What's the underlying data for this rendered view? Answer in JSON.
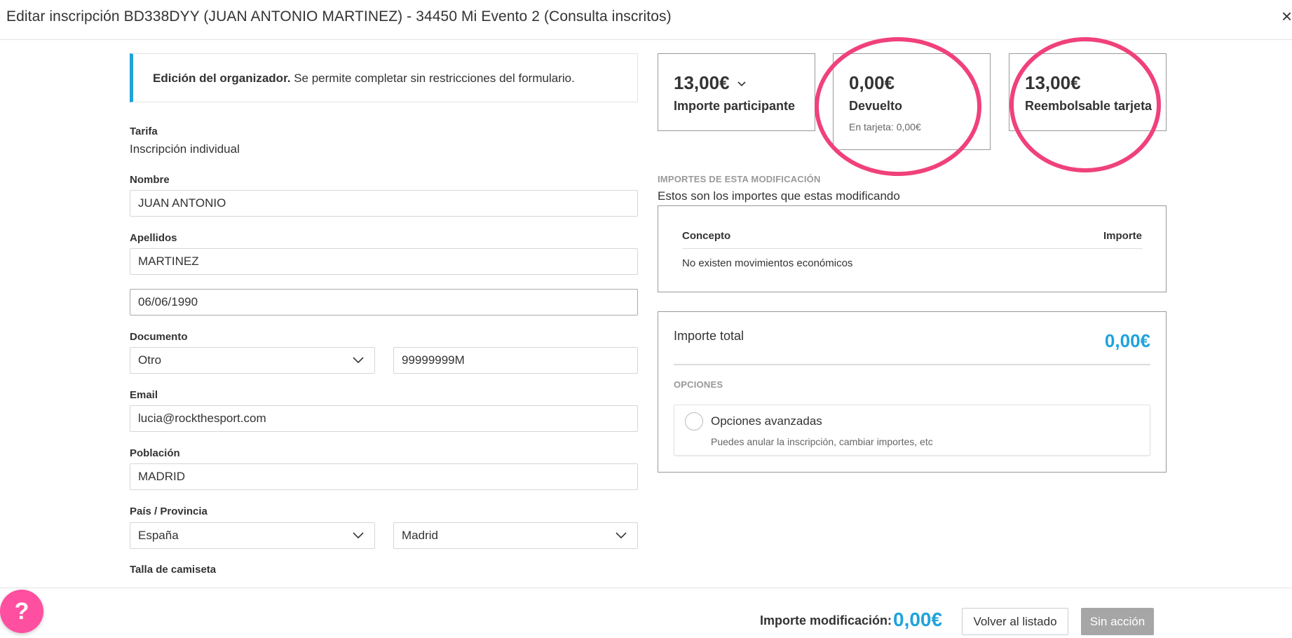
{
  "header": {
    "title": "Editar inscripción BD338DYY (JUAN ANTONIO MARTINEZ) - 34450 Mi Evento 2 (Consulta inscritos)",
    "close_glyph": "×"
  },
  "notice": {
    "bold": "Edición del organizador.",
    "text": " Se permite completar sin restricciones del formulario."
  },
  "form": {
    "tarifa_label": "Tarifa",
    "tarifa_value": "Inscripción individual",
    "nombre_label": "Nombre",
    "nombre_value": "JUAN ANTONIO",
    "apellidos_label": "Apellidos",
    "apellidos_value": "MARTINEZ",
    "fecha_value": "06/06/1990",
    "documento_label": "Documento",
    "documento_tipo": "Otro",
    "documento_numero": "99999999M",
    "email_label": "Email",
    "email_value": "lucia@rockthesport.com",
    "poblacion_label": "Población",
    "poblacion_value": "MADRID",
    "pais_label": "País / Provincia",
    "pais_value": "España",
    "provincia_value": "Madrid",
    "talla_label": "Talla de camiseta"
  },
  "cards": {
    "participante": {
      "amount": "13,00€",
      "label": "Importe participante"
    },
    "devuelto": {
      "amount": "0,00€",
      "label": "Devuelto",
      "note": "En tarjeta: 0,00€"
    },
    "reembolsable": {
      "amount": "13,00€",
      "label": "Reembolsable tarjeta"
    }
  },
  "annotation_color": "#f0417a",
  "modificacion": {
    "section_title": "IMPORTES DE ESTA MODIFICACIÓN",
    "description": "Estos son los importes que estas modificando",
    "col_concepto": "Concepto",
    "col_importe": "Importe",
    "empty_message": "No existen movimientos económicos"
  },
  "total": {
    "label": "Importe total",
    "value": "0,00€",
    "options_title": "OPCIONES",
    "option_title": "Opciones avanzadas",
    "option_desc": "Puedes anular la inscripción, cambiar importes, etc"
  },
  "footer": {
    "help_glyph": "?",
    "modificacion_label": "Importe modificación:",
    "modificacion_value": "0,00€",
    "back_button": "Volver al listado",
    "no_action_button": "Sin acción"
  },
  "colors": {
    "accent": "#1fa3db",
    "help": "#ff4fa0",
    "disabled_button": "#a6a6a6"
  }
}
